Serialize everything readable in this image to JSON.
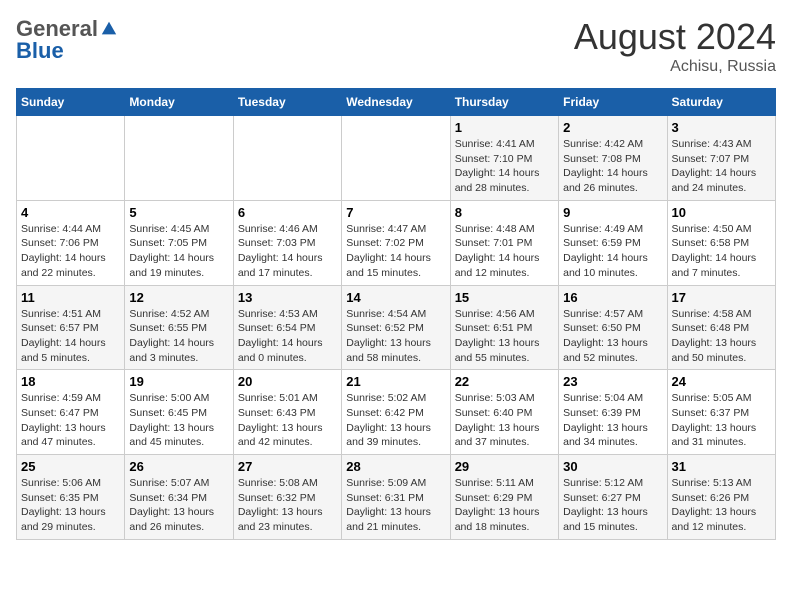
{
  "logo": {
    "general": "General",
    "blue": "Blue"
  },
  "header": {
    "month_year": "August 2024",
    "location": "Achisu, Russia"
  },
  "weekdays": [
    "Sunday",
    "Monday",
    "Tuesday",
    "Wednesday",
    "Thursday",
    "Friday",
    "Saturday"
  ],
  "weeks": [
    [
      {
        "day": "",
        "info": ""
      },
      {
        "day": "",
        "info": ""
      },
      {
        "day": "",
        "info": ""
      },
      {
        "day": "",
        "info": ""
      },
      {
        "day": "1",
        "info": "Sunrise: 4:41 AM\nSunset: 7:10 PM\nDaylight: 14 hours\nand 28 minutes."
      },
      {
        "day": "2",
        "info": "Sunrise: 4:42 AM\nSunset: 7:08 PM\nDaylight: 14 hours\nand 26 minutes."
      },
      {
        "day": "3",
        "info": "Sunrise: 4:43 AM\nSunset: 7:07 PM\nDaylight: 14 hours\nand 24 minutes."
      }
    ],
    [
      {
        "day": "4",
        "info": "Sunrise: 4:44 AM\nSunset: 7:06 PM\nDaylight: 14 hours\nand 22 minutes."
      },
      {
        "day": "5",
        "info": "Sunrise: 4:45 AM\nSunset: 7:05 PM\nDaylight: 14 hours\nand 19 minutes."
      },
      {
        "day": "6",
        "info": "Sunrise: 4:46 AM\nSunset: 7:03 PM\nDaylight: 14 hours\nand 17 minutes."
      },
      {
        "day": "7",
        "info": "Sunrise: 4:47 AM\nSunset: 7:02 PM\nDaylight: 14 hours\nand 15 minutes."
      },
      {
        "day": "8",
        "info": "Sunrise: 4:48 AM\nSunset: 7:01 PM\nDaylight: 14 hours\nand 12 minutes."
      },
      {
        "day": "9",
        "info": "Sunrise: 4:49 AM\nSunset: 6:59 PM\nDaylight: 14 hours\nand 10 minutes."
      },
      {
        "day": "10",
        "info": "Sunrise: 4:50 AM\nSunset: 6:58 PM\nDaylight: 14 hours\nand 7 minutes."
      }
    ],
    [
      {
        "day": "11",
        "info": "Sunrise: 4:51 AM\nSunset: 6:57 PM\nDaylight: 14 hours\nand 5 minutes."
      },
      {
        "day": "12",
        "info": "Sunrise: 4:52 AM\nSunset: 6:55 PM\nDaylight: 14 hours\nand 3 minutes."
      },
      {
        "day": "13",
        "info": "Sunrise: 4:53 AM\nSunset: 6:54 PM\nDaylight: 14 hours\nand 0 minutes."
      },
      {
        "day": "14",
        "info": "Sunrise: 4:54 AM\nSunset: 6:52 PM\nDaylight: 13 hours\nand 58 minutes."
      },
      {
        "day": "15",
        "info": "Sunrise: 4:56 AM\nSunset: 6:51 PM\nDaylight: 13 hours\nand 55 minutes."
      },
      {
        "day": "16",
        "info": "Sunrise: 4:57 AM\nSunset: 6:50 PM\nDaylight: 13 hours\nand 52 minutes."
      },
      {
        "day": "17",
        "info": "Sunrise: 4:58 AM\nSunset: 6:48 PM\nDaylight: 13 hours\nand 50 minutes."
      }
    ],
    [
      {
        "day": "18",
        "info": "Sunrise: 4:59 AM\nSunset: 6:47 PM\nDaylight: 13 hours\nand 47 minutes."
      },
      {
        "day": "19",
        "info": "Sunrise: 5:00 AM\nSunset: 6:45 PM\nDaylight: 13 hours\nand 45 minutes."
      },
      {
        "day": "20",
        "info": "Sunrise: 5:01 AM\nSunset: 6:43 PM\nDaylight: 13 hours\nand 42 minutes."
      },
      {
        "day": "21",
        "info": "Sunrise: 5:02 AM\nSunset: 6:42 PM\nDaylight: 13 hours\nand 39 minutes."
      },
      {
        "day": "22",
        "info": "Sunrise: 5:03 AM\nSunset: 6:40 PM\nDaylight: 13 hours\nand 37 minutes."
      },
      {
        "day": "23",
        "info": "Sunrise: 5:04 AM\nSunset: 6:39 PM\nDaylight: 13 hours\nand 34 minutes."
      },
      {
        "day": "24",
        "info": "Sunrise: 5:05 AM\nSunset: 6:37 PM\nDaylight: 13 hours\nand 31 minutes."
      }
    ],
    [
      {
        "day": "25",
        "info": "Sunrise: 5:06 AM\nSunset: 6:35 PM\nDaylight: 13 hours\nand 29 minutes."
      },
      {
        "day": "26",
        "info": "Sunrise: 5:07 AM\nSunset: 6:34 PM\nDaylight: 13 hours\nand 26 minutes."
      },
      {
        "day": "27",
        "info": "Sunrise: 5:08 AM\nSunset: 6:32 PM\nDaylight: 13 hours\nand 23 minutes."
      },
      {
        "day": "28",
        "info": "Sunrise: 5:09 AM\nSunset: 6:31 PM\nDaylight: 13 hours\nand 21 minutes."
      },
      {
        "day": "29",
        "info": "Sunrise: 5:11 AM\nSunset: 6:29 PM\nDaylight: 13 hours\nand 18 minutes."
      },
      {
        "day": "30",
        "info": "Sunrise: 5:12 AM\nSunset: 6:27 PM\nDaylight: 13 hours\nand 15 minutes."
      },
      {
        "day": "31",
        "info": "Sunrise: 5:13 AM\nSunset: 6:26 PM\nDaylight: 13 hours\nand 12 minutes."
      }
    ]
  ]
}
